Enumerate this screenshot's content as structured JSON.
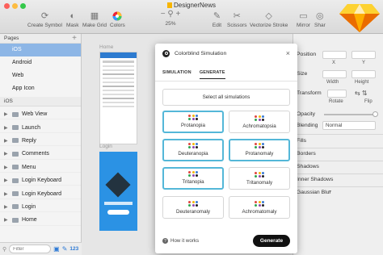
{
  "window": {
    "title": "DesignerNews"
  },
  "toolbar": {
    "create_symbol": "Create Symbol",
    "mask": "Mask",
    "make_grid": "Make Grid",
    "colors": "Colors",
    "zoom": "25%",
    "edit": "Edit",
    "scissors": "Scissors",
    "vectorize": "Vectorize Stroke",
    "mirror": "Mirror",
    "share": "Shar"
  },
  "sidebar": {
    "pages_header": "Pages",
    "pages": [
      "iOS",
      "Android",
      "Web",
      "App Icon"
    ],
    "layers_header": "iOS",
    "layers": [
      "Web View",
      "Launch",
      "Reply",
      "Comments",
      "Menu",
      "Login Keyboard",
      "Login Keyboard",
      "Login",
      "Home"
    ],
    "filter_placeholder": "Filter",
    "filter_count": "123"
  },
  "canvas": {
    "artboards": [
      "Home",
      "Login"
    ]
  },
  "inspector": {
    "position": "Position",
    "x": "X",
    "y": "Y",
    "size": "Size",
    "width": "Width",
    "height": "Height",
    "transform": "Transform",
    "rotate": "Rotate",
    "flip": "Flip",
    "opacity": "Opacity",
    "blending": "Blending",
    "blending_value": "Normal",
    "fills": "Fills",
    "borders": "Borders",
    "shadows": "Shadows",
    "inner_shadows": "Inner Shadows",
    "gaussian_blur": "Gaussian Blur"
  },
  "modal": {
    "title": "Colorblind Simulation",
    "close": "×",
    "tabs": [
      "SIMULATION",
      "GENERATE"
    ],
    "active_tab": "GENERATE",
    "select_all": "Select all simulations",
    "options": [
      {
        "label": "Protanopia",
        "selected": true
      },
      {
        "label": "Achromatopsia",
        "selected": false
      },
      {
        "label": "Deuteranopia",
        "selected": true
      },
      {
        "label": "Protanomaly",
        "selected": true
      },
      {
        "label": "Tritanopia",
        "selected": true
      },
      {
        "label": "Tritanomaly",
        "selected": false
      },
      {
        "label": "Deuteranomaly",
        "selected": false
      },
      {
        "label": "Achromatomaly",
        "selected": false
      }
    ],
    "how_it_works": "How it works",
    "generate": "Generate"
  },
  "colors": {
    "selection": "#8db6e6",
    "option_selected_border": "#54b7d8",
    "generate_button": "#111111",
    "sketch_logo": "#f7b500"
  }
}
